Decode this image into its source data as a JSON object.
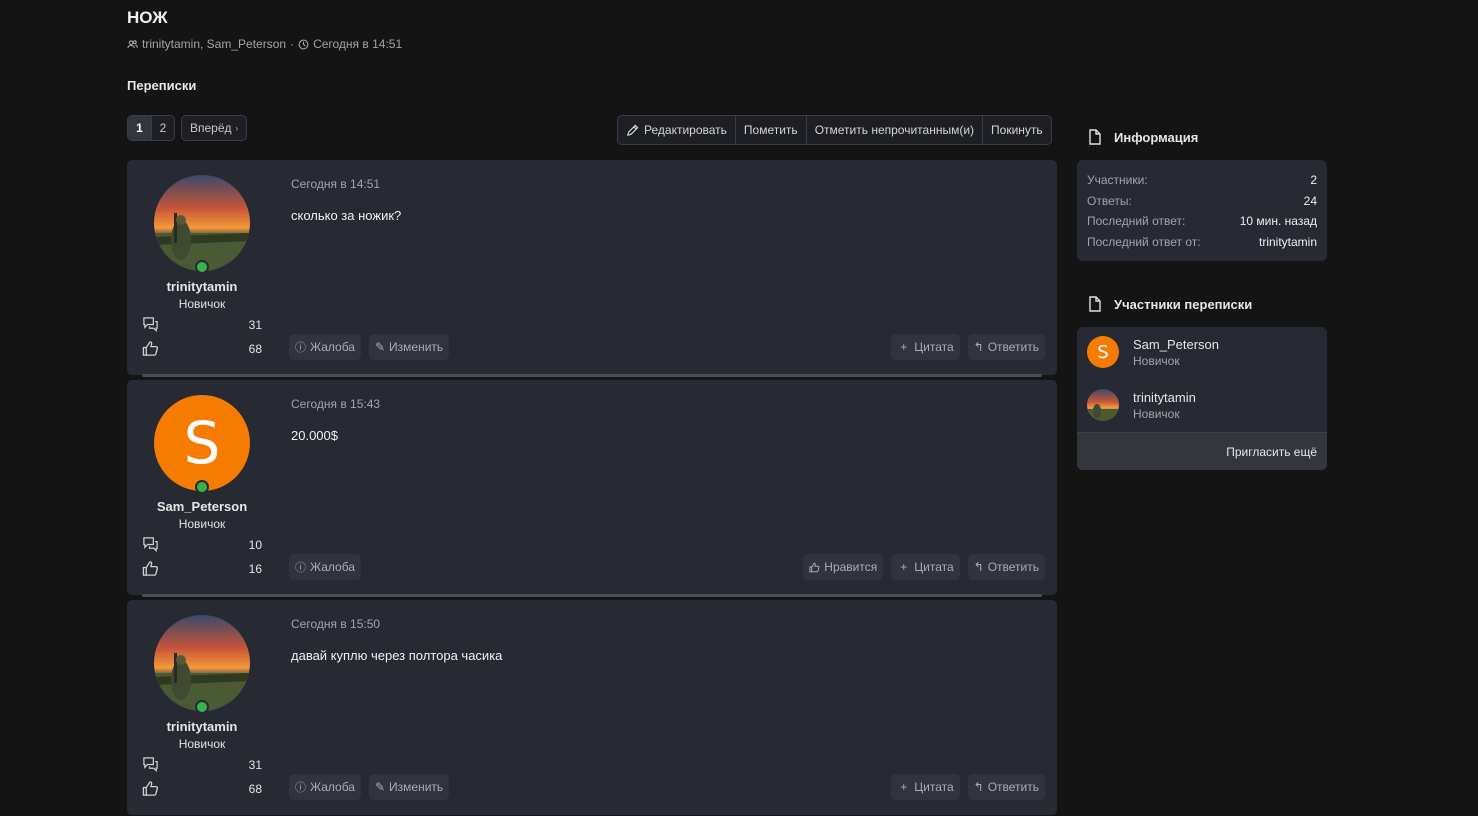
{
  "thread": {
    "title": "НОЖ",
    "participants": "trinitytamin, Sam_Peterson",
    "separator": "·",
    "time": "Сегодня в 14:51"
  },
  "breadcrumb": "Переписки",
  "pagination": {
    "pages": [
      "1",
      "2"
    ],
    "current": "1",
    "next_label": "Вперёд"
  },
  "actions": {
    "edit": "Редактировать",
    "mark": "Пометить",
    "mark_unread": "Отметить непрочитанным(и)",
    "leave": "Покинуть"
  },
  "posts": [
    {
      "username": "trinitytamin",
      "role": "Новичок",
      "avatar": "photo",
      "messages": "31",
      "likes": "68",
      "date": "Сегодня в 14:51",
      "text": "сколько за ножик?",
      "left_buttons": [
        "Жалоба",
        "Изменить"
      ],
      "right_buttons": [
        "Цитата",
        "Ответить"
      ]
    },
    {
      "username": "Sam_Peterson",
      "role": "Новичок",
      "avatar": "S",
      "messages": "10",
      "likes": "16",
      "date": "Сегодня в 15:43",
      "text": "20.000$",
      "left_buttons": [
        "Жалоба"
      ],
      "right_buttons": [
        "Нравится",
        "Цитата",
        "Ответить"
      ]
    },
    {
      "username": "trinitytamin",
      "role": "Новичок",
      "avatar": "photo",
      "messages": "31",
      "likes": "68",
      "date": "Сегодня в 15:50",
      "text": "давай куплю через полтора часика",
      "left_buttons": [
        "Жалоба",
        "Изменить"
      ],
      "right_buttons": [
        "Цитата",
        "Ответить"
      ]
    }
  ],
  "sidebar": {
    "info_title": "Информация",
    "info_rows": [
      {
        "label": "Участники:",
        "value": "2"
      },
      {
        "label": "Ответы:",
        "value": "24"
      },
      {
        "label": "Последний ответ:",
        "value": "10 мин. назад"
      },
      {
        "label": "Последний ответ от:",
        "value": "trinitytamin"
      }
    ],
    "members_title": "Участники переписки",
    "members": [
      {
        "name": "Sam_Peterson",
        "role": "Новичок",
        "avatar": "S"
      },
      {
        "name": "trinitytamin",
        "role": "Новичок",
        "avatar": "photo"
      }
    ],
    "invite_label": "Пригласить ещё"
  },
  "colors": {
    "background": "#141414",
    "card": "#272a33",
    "avatar_orange": "#f57c00",
    "online_green": "#37b24d"
  }
}
